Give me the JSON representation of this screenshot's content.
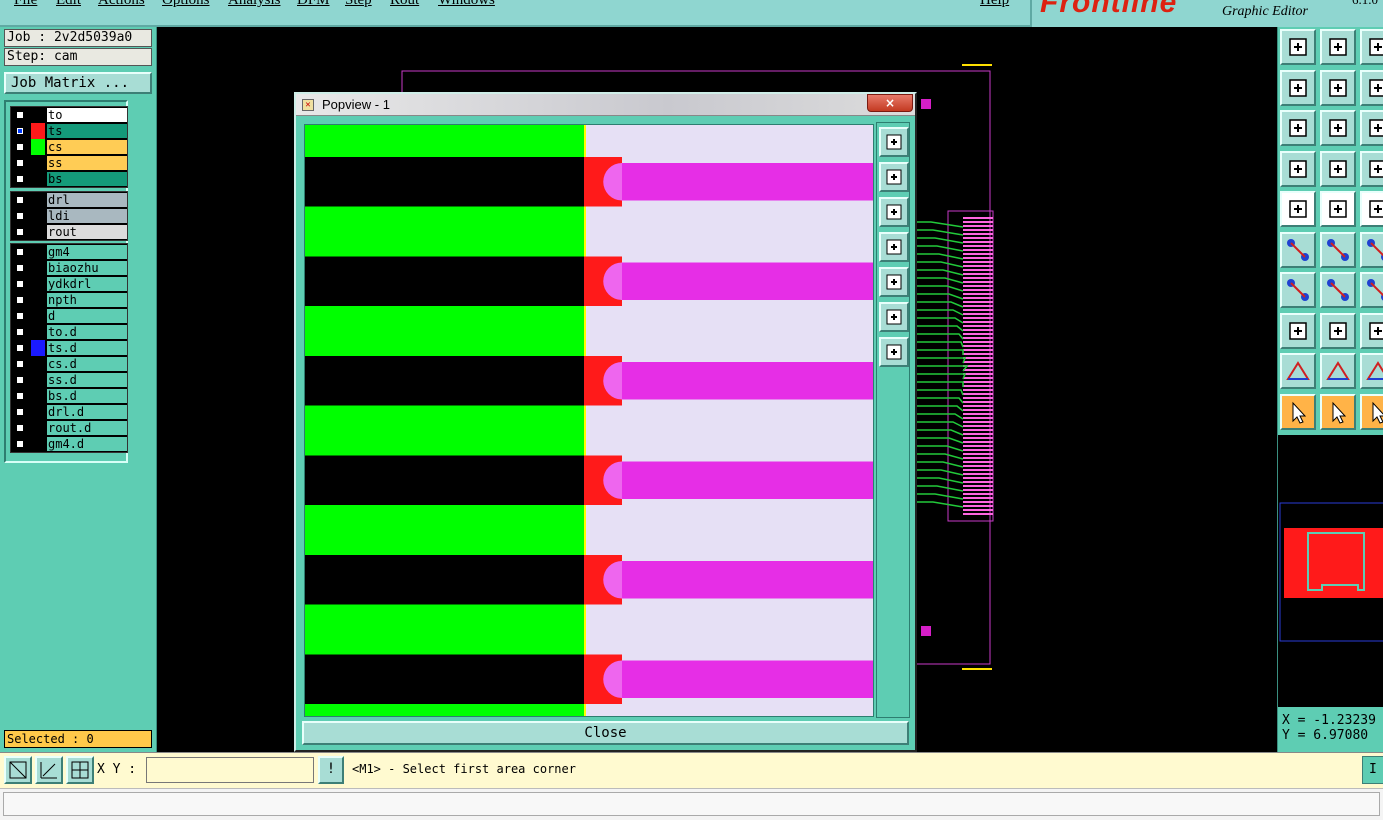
{
  "menubar": {
    "items": [
      "File",
      "Edit",
      "Actions",
      "Options",
      "Analysis",
      "DFM",
      "Step",
      "Rout",
      "Windows"
    ],
    "help": "Help"
  },
  "brand": {
    "logo": "Frontline",
    "subtitle": "Graphic Editor",
    "version": "6.1.0"
  },
  "left_panel": {
    "job_label": "Job : 2v2d5039a0",
    "step_label": "Step: cam",
    "job_matrix_button": "Job Matrix ...",
    "selected_label": "Selected : 0",
    "layer_groups": [
      {
        "layers": [
          {
            "name": "to",
            "color": "#000000",
            "bg": "#ffffff",
            "checked": false
          },
          {
            "name": "ts",
            "color": "#ff1a1a",
            "bg": "#149a7a",
            "checked": true
          },
          {
            "name": "cs",
            "color": "#00ff00",
            "bg": "#ffcc55",
            "checked": false
          },
          {
            "name": "ss",
            "color": "#000000",
            "bg": "#ffcc55",
            "checked": false
          },
          {
            "name": "bs",
            "color": "#000000",
            "bg": "#149a7a",
            "checked": false
          }
        ]
      },
      {
        "layers": [
          {
            "name": "drl",
            "color": "#000000",
            "bg": "#a9b8c0",
            "checked": false
          },
          {
            "name": "ldi",
            "color": "#000000",
            "bg": "#a9b8c0",
            "checked": false
          },
          {
            "name": "rout",
            "color": "#000000",
            "bg": "#dcdcdc",
            "checked": false
          }
        ]
      },
      {
        "layers": [
          {
            "name": "gm4",
            "color": "#000000",
            "bg": "#5ecdb3",
            "checked": false
          },
          {
            "name": "biaozhu",
            "color": "#000000",
            "bg": "#5ecdb3",
            "checked": false
          },
          {
            "name": "ydkdrl",
            "color": "#000000",
            "bg": "#5ecdb3",
            "checked": false
          },
          {
            "name": "npth",
            "color": "#000000",
            "bg": "#5ecdb3",
            "checked": false
          },
          {
            "name": "d",
            "color": "#000000",
            "bg": "#5ecdb3",
            "checked": false
          },
          {
            "name": "to.d",
            "color": "#000000",
            "bg": "#5ecdb3",
            "checked": false
          },
          {
            "name": "ts.d",
            "color": "#1a1aff",
            "bg": "#5ecdb3",
            "checked": false
          },
          {
            "name": "cs.d",
            "color": "#000000",
            "bg": "#5ecdb3",
            "checked": false
          },
          {
            "name": "ss.d",
            "color": "#000000",
            "bg": "#5ecdb3",
            "checked": false
          },
          {
            "name": "bs.d",
            "color": "#000000",
            "bg": "#5ecdb3",
            "checked": false
          },
          {
            "name": "drl.d",
            "color": "#000000",
            "bg": "#5ecdb3",
            "checked": false
          },
          {
            "name": "rout.d",
            "color": "#000000",
            "bg": "#5ecdb3",
            "checked": false
          },
          {
            "name": "gm4.d",
            "color": "#000000",
            "bg": "#5ecdb3",
            "checked": false
          }
        ]
      }
    ]
  },
  "popview": {
    "title": "Popview - 1",
    "close_x": "×",
    "close_button": "Close",
    "side_buttons": [
      "zoom-home-icon",
      "move-up-icon",
      "move-down-icon",
      "move-left-icon",
      "move-right-icon",
      "zoom-fit-icon",
      "zoom-area-icon"
    ]
  },
  "coords": {
    "x": "X = -1.23239",
    "y": "Y = 6.97080"
  },
  "bottom_bar": {
    "xy_label": "X Y :",
    "xy_value": "",
    "info_glyph": "!",
    "prompt": "<M1> - Select first area corner",
    "right_button": "I"
  },
  "colors": {
    "panel": "#5ecdb3",
    "button": "#a8ddd5",
    "green_layer": "#00ff00",
    "magenta_layer": "#e62ee6",
    "red_layer": "#ff1a1a",
    "lavender_layer": "#e6e0f5"
  }
}
